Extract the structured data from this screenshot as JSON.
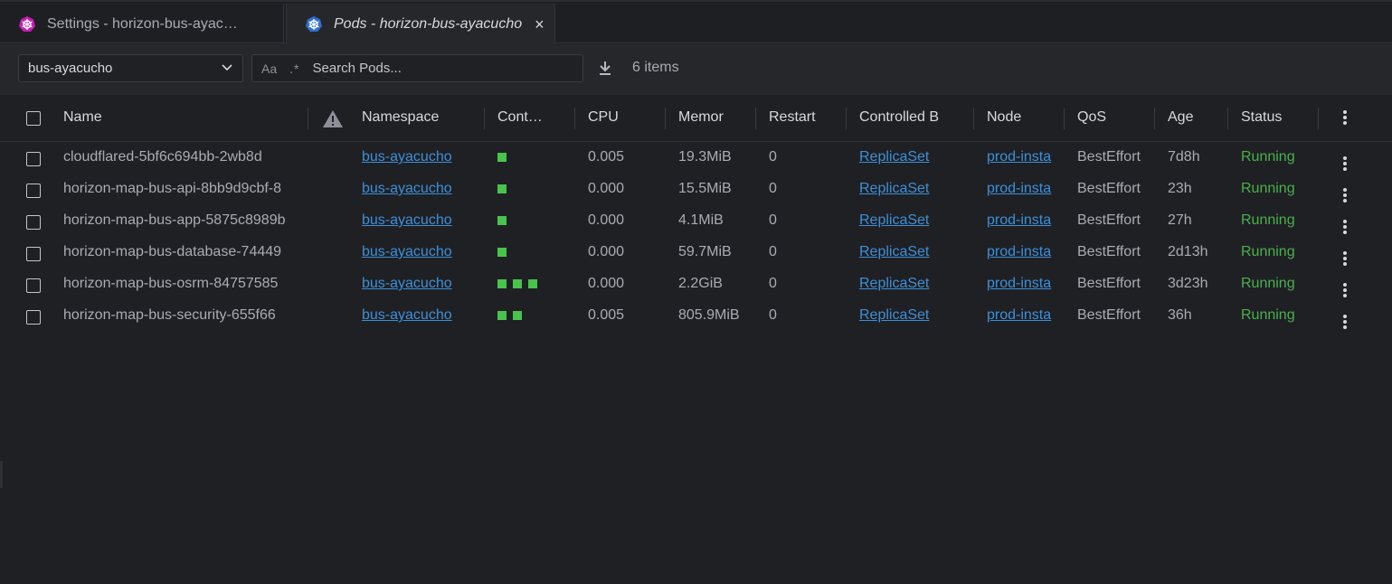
{
  "tabs": [
    {
      "label": "Settings - horizon-bus-ayac…",
      "icon": "kubernetes-icon",
      "icon_color": "#c21fb2",
      "active": false
    },
    {
      "label": "Pods - horizon-bus-ayacucho",
      "icon": "kubernetes-icon",
      "icon_color": "#2f6fd1",
      "active": true,
      "close": "×"
    }
  ],
  "toolbar": {
    "namespace": "bus-ayacucho",
    "search_case": "Aa",
    "search_regex": ".*",
    "search_placeholder": "Search Pods...",
    "items_count": "6 items"
  },
  "columns": {
    "name": "Name",
    "namespace": "Namespace",
    "containers": "Cont…",
    "cpu": "CPU",
    "memory": "Memor",
    "restarts": "Restart",
    "controlled_by": "Controlled B",
    "node": "Node",
    "qos": "QoS",
    "age": "Age",
    "status": "Status"
  },
  "colors": {
    "accent_link": "#3d8fd8",
    "running": "#4caf50",
    "container_ok": "#48c34c"
  },
  "pods": [
    {
      "name": "cloudflared-5bf6c694bb-2wb8d",
      "namespace": "bus-ayacucho",
      "containers": 1,
      "cpu": "0.005",
      "memory": "19.3MiB",
      "restarts": "0",
      "controlled_by": "ReplicaSet",
      "node": "prod-insta",
      "qos": "BestEffort",
      "age": "7d8h",
      "status": "Running"
    },
    {
      "name": "horizon-map-bus-api-8bb9d9cbf-8",
      "namespace": "bus-ayacucho",
      "containers": 1,
      "cpu": "0.000",
      "memory": "15.5MiB",
      "restarts": "0",
      "controlled_by": "ReplicaSet",
      "node": "prod-insta",
      "qos": "BestEffort",
      "age": "23h",
      "status": "Running"
    },
    {
      "name": "horizon-map-bus-app-5875c8989b",
      "namespace": "bus-ayacucho",
      "containers": 1,
      "cpu": "0.000",
      "memory": "4.1MiB",
      "restarts": "0",
      "controlled_by": "ReplicaSet",
      "node": "prod-insta",
      "qos": "BestEffort",
      "age": "27h",
      "status": "Running"
    },
    {
      "name": "horizon-map-bus-database-74449",
      "namespace": "bus-ayacucho",
      "containers": 1,
      "cpu": "0.000",
      "memory": "59.7MiB",
      "restarts": "0",
      "controlled_by": "ReplicaSet",
      "node": "prod-insta",
      "qos": "BestEffort",
      "age": "2d13h",
      "status": "Running"
    },
    {
      "name": "horizon-map-bus-osrm-84757585",
      "namespace": "bus-ayacucho",
      "containers": 3,
      "cpu": "0.000",
      "memory": "2.2GiB",
      "restarts": "0",
      "controlled_by": "ReplicaSet",
      "node": "prod-insta",
      "qos": "BestEffort",
      "age": "3d23h",
      "status": "Running"
    },
    {
      "name": "horizon-map-bus-security-655f66",
      "namespace": "bus-ayacucho",
      "containers": 2,
      "cpu": "0.005",
      "memory": "805.9MiB",
      "restarts": "0",
      "controlled_by": "ReplicaSet",
      "node": "prod-insta",
      "qos": "BestEffort",
      "age": "36h",
      "status": "Running"
    }
  ]
}
